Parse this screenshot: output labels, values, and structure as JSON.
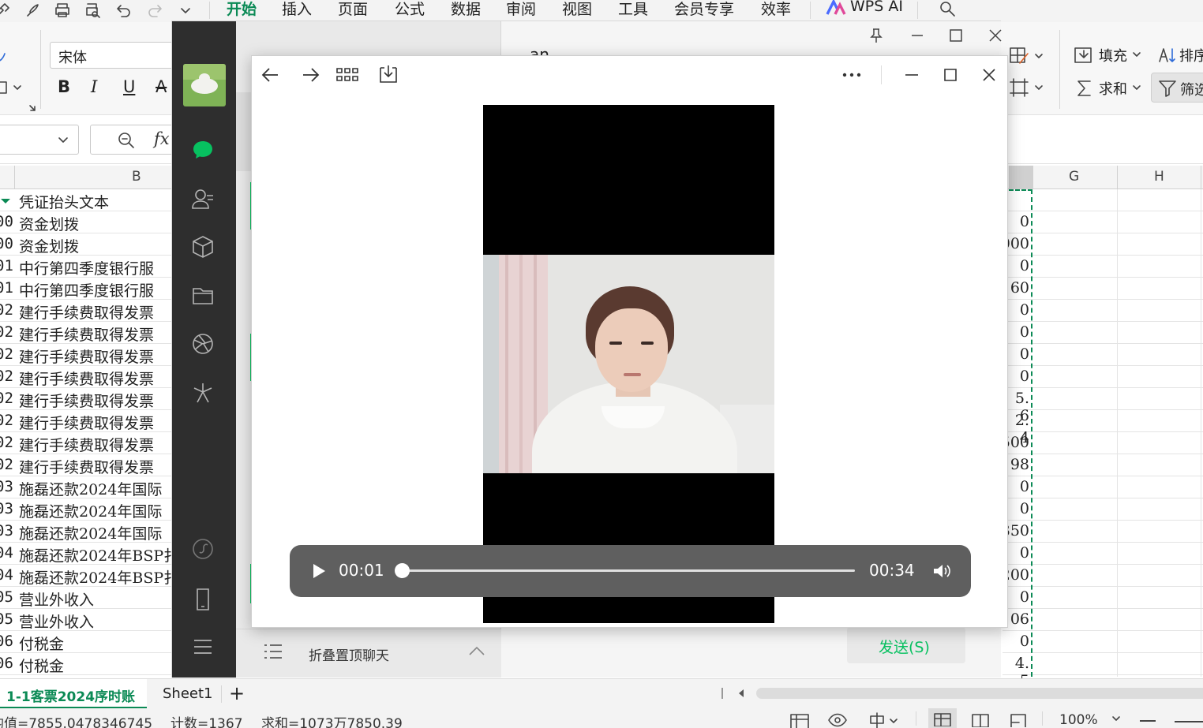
{
  "wps": {
    "menus": [
      "开始",
      "插入",
      "页面",
      "公式",
      "数据",
      "审阅",
      "视图",
      "工具",
      "会员专享",
      "效率"
    ],
    "wps_ai": "WPS AI",
    "ribbon": {
      "font_name": "宋体",
      "fill_label": "填充",
      "sum_label": "求和",
      "sort_label": "排序",
      "filter_label": "筛选"
    },
    "formula": {
      "fx": "fx"
    },
    "columns": {
      "B": "B",
      "G": "G",
      "H": "H"
    },
    "rows": [
      {
        "code": "",
        "text": "凭证抬头文本"
      },
      {
        "code": "00",
        "text": "资金划拨"
      },
      {
        "code": "00",
        "text": "资金划拨"
      },
      {
        "code": "01",
        "text": "中行第四季度银行服"
      },
      {
        "code": "01",
        "text": "中行第四季度银行服"
      },
      {
        "code": "02",
        "text": "建行手续费取得发票"
      },
      {
        "code": "02",
        "text": "建行手续费取得发票"
      },
      {
        "code": "02",
        "text": "建行手续费取得发票"
      },
      {
        "code": "02",
        "text": "建行手续费取得发票"
      },
      {
        "code": "02",
        "text": "建行手续费取得发票"
      },
      {
        "code": "02",
        "text": "建行手续费取得发票"
      },
      {
        "code": "02",
        "text": "建行手续费取得发票"
      },
      {
        "code": "02",
        "text": "建行手续费取得发票"
      },
      {
        "code": "03",
        "text": "施磊还款2024年国际"
      },
      {
        "code": "03",
        "text": "施磊还款2024年国际"
      },
      {
        "code": "03",
        "text": "施磊还款2024年国际"
      },
      {
        "code": "04",
        "text": "施磊还款2024年BSP扌"
      },
      {
        "code": "04",
        "text": "施磊还款2024年BSP扌"
      },
      {
        "code": "05",
        "text": "营业外收入"
      },
      {
        "code": "05",
        "text": "营业外收入"
      },
      {
        "code": "06",
        "text": "付税金"
      },
      {
        "code": "06",
        "text": "付税金"
      }
    ],
    "right_values": [
      "",
      "0",
      "000",
      "0",
      "60",
      "0",
      "0",
      "0",
      "0",
      "5. 6",
      "2. 4",
      "500",
      "98",
      "0",
      "0",
      "350",
      "0",
      "200",
      "0",
      "06",
      "0",
      "4. 5"
    ],
    "sheet_tabs": [
      "1-1客票2024序时账",
      "Sheet1"
    ],
    "status": {
      "avg": "均值=7855.0478346745",
      "count": "计数=1367",
      "sum": "求和=1073万7850.39",
      "zoom": "100%"
    }
  },
  "wechat": {
    "chat_title_partial": "an",
    "fold_label": "折叠置顶聊天",
    "send_button": "发送(S)"
  },
  "viewer": {
    "current_time": "00:01",
    "duration": "00:34",
    "progress": 0.0
  },
  "colors": {
    "wps_green": "#0b8a55",
    "wechat_green": "#07c160",
    "sidebar_dark": "#2e2e2e",
    "video_controls": "#5f5f5f"
  }
}
